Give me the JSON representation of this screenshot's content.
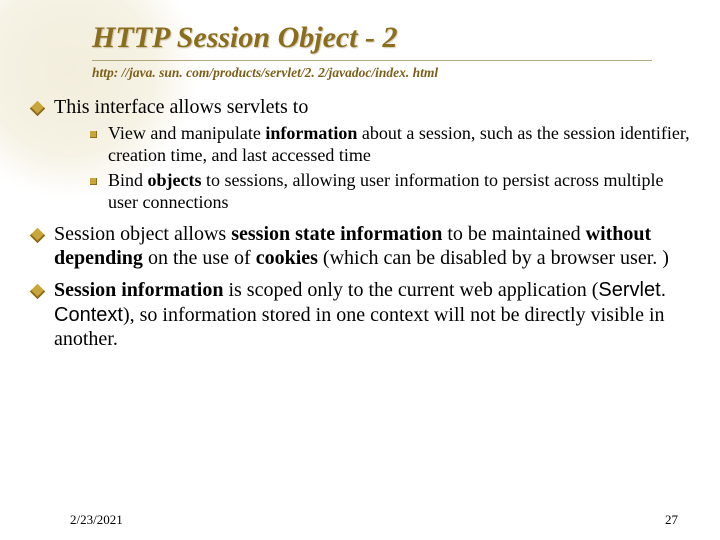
{
  "title": "HTTP Session Object - 2",
  "subtitle": "http: //java. sun. com/products/servlet/2. 2/javadoc/index. html",
  "bullets": {
    "b1_intro": "This interface allows servlets to",
    "b1_sub1_pre": "View and manipulate ",
    "b1_sub1_bold": "information",
    "b1_sub1_post": " about a session, such as the session identifier, creation time, and last accessed time",
    "b1_sub2_pre": "Bind ",
    "b1_sub2_bold": "objects",
    "b1_sub2_post": " to sessions, allowing user information to persist across multiple user connections",
    "b2_p1": "Session object allows ",
    "b2_p2": "session state information",
    "b2_p3": " to be maintained ",
    "b2_p4": "without depending",
    "b2_p5": " on the use of ",
    "b2_p6": "cookies",
    "b2_p7": " (which can be disabled by a browser user. )",
    "b3_p1": "Session information",
    "b3_p2": " is scoped only to the current web application (",
    "b3_code": "Servlet. Context",
    "b3_p3": "), so information stored in one context will not be directly visible in another."
  },
  "footer": {
    "date": "2/23/2021",
    "page": "27"
  }
}
